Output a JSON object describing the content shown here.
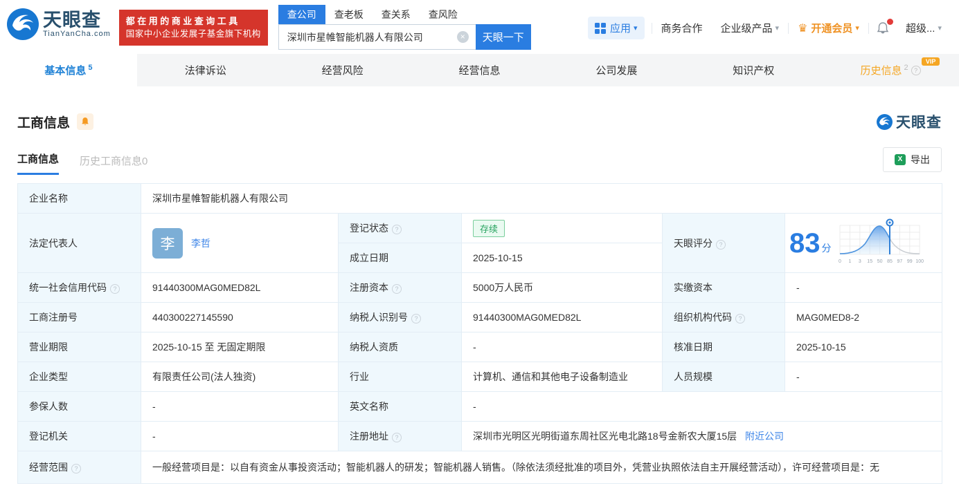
{
  "icons": {
    "caret_down": "▾",
    "clear": "×",
    "crown": "♛",
    "help": "?",
    "excel": "X"
  },
  "header": {
    "logo": {
      "brand": "天眼查",
      "domain": "TianYanCha.com"
    },
    "slogan": {
      "line1": "都在用的商业查询工具",
      "line2": "国家中小企业发展子基金旗下机构"
    },
    "search": {
      "tabs": [
        {
          "label": "查公司"
        },
        {
          "label": "查老板"
        },
        {
          "label": "查关系"
        },
        {
          "label": "查风险"
        }
      ],
      "value": "深圳市星帷智能机器人有限公司",
      "button": "天眼一下"
    },
    "menu": {
      "apps": "应用",
      "business": "商务合作",
      "enterprise": "企业级产品",
      "vip": "开通会员",
      "user": "超级..."
    }
  },
  "nav_tabs": [
    {
      "label": "基本信息",
      "count": "5"
    },
    {
      "label": "法律诉讼"
    },
    {
      "label": "经营风险"
    },
    {
      "label": "经营信息"
    },
    {
      "label": "公司发展"
    },
    {
      "label": "知识产权"
    },
    {
      "label": "历史信息",
      "count": "2",
      "badge": "VIP"
    }
  ],
  "section": {
    "title": "工商信息",
    "watermark": "天眼查",
    "subtabs": [
      {
        "label": "工商信息"
      },
      {
        "label": "历史工商信息0"
      }
    ],
    "export_label": "导出"
  },
  "table": {
    "company_name": {
      "label": "企业名称",
      "value": "深圳市星帷智能机器人有限公司"
    },
    "legal_rep": {
      "label": "法定代表人",
      "avatar": "李",
      "name": "李哲"
    },
    "reg_status": {
      "label": "登记状态",
      "value": "存续"
    },
    "establish_date": {
      "label": "成立日期",
      "value": "2025-10-15"
    },
    "score": {
      "label": "天眼评分",
      "value": "83",
      "unit": "分"
    },
    "credit_code": {
      "label": "统一社会信用代码",
      "value": "91440300MAG0MED82L"
    },
    "reg_capital": {
      "label": "注册资本",
      "value": "5000万人民币"
    },
    "paid_capital": {
      "label": "实缴资本",
      "value": "-"
    },
    "reg_number": {
      "label": "工商注册号",
      "value": "440300227145590"
    },
    "taxpayer_id": {
      "label": "纳税人识别号",
      "value": "91440300MAG0MED82L"
    },
    "org_code": {
      "label": "组织机构代码",
      "value": "MAG0MED8-2"
    },
    "business_term": {
      "label": "营业期限",
      "value": "2025-10-15 至 无固定期限"
    },
    "taxpayer_quali": {
      "label": "纳税人资质",
      "value": "-"
    },
    "approval_date": {
      "label": "核准日期",
      "value": "2025-10-15"
    },
    "company_type": {
      "label": "企业类型",
      "value": "有限责任公司(法人独资)"
    },
    "industry": {
      "label": "行业",
      "value": "计算机、通信和其他电子设备制造业"
    },
    "staff_size": {
      "label": "人员规模",
      "value": "-"
    },
    "insured_count": {
      "label": "参保人数",
      "value": "-"
    },
    "english_name": {
      "label": "英文名称",
      "value": "-"
    },
    "reg_authority": {
      "label": "登记机关",
      "value": "-"
    },
    "reg_address": {
      "label": "注册地址",
      "value": "深圳市光明区光明街道东周社区光电北路18号金新农大厦15层",
      "link": "附近公司"
    },
    "business_scope": {
      "label": "经营范围",
      "value": "一般经营项目是：以自有资金从事投资活动；智能机器人的研发；智能机器人销售。（除依法须经批准的项目外，凭营业执照依法自主开展经营活动），许可经营项目是：无"
    }
  },
  "chart_data": {
    "type": "area",
    "title": "天眼评分",
    "score": 83,
    "marker_at": 85,
    "x_ticks": [
      "0",
      "1",
      "3",
      "15",
      "50",
      "85",
      "97",
      "99",
      "100"
    ],
    "note": "钟形分布曲线，标记位于85刻度处，左侧蓝色渐变填充，右侧灰色"
  }
}
